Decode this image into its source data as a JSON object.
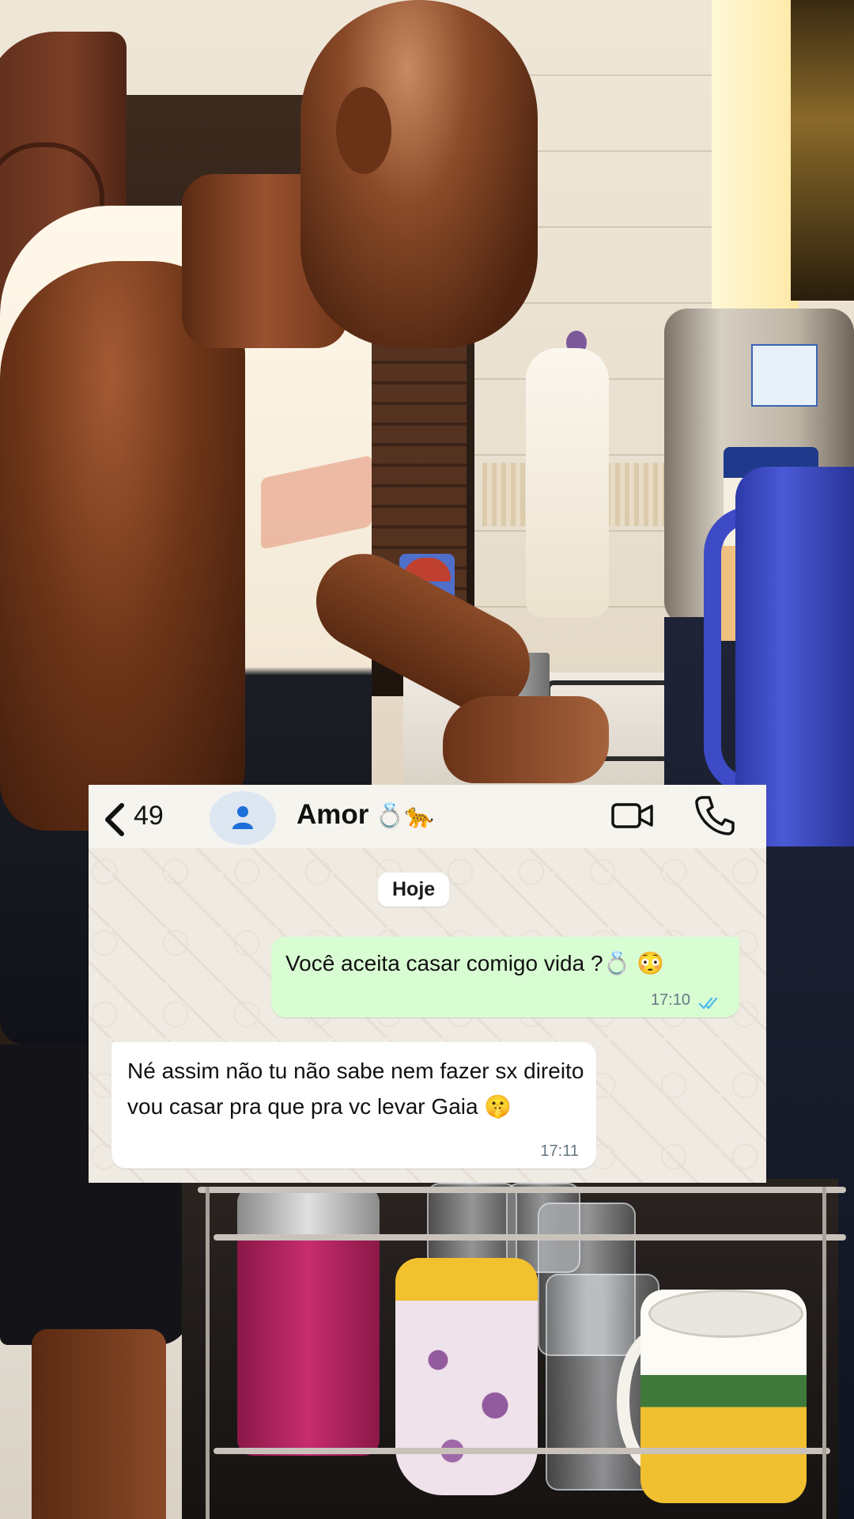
{
  "chat": {
    "unread_count": "49",
    "contact_name": "Amor",
    "contact_emojis": "💍🐆",
    "date_chip": "Hoje",
    "messages": [
      {
        "direction": "outgoing",
        "text": "Você aceita casar comigo vida ?💍 😳",
        "time": "17:10",
        "status": "read"
      },
      {
        "direction": "incoming",
        "text": "Né assim não tu não sabe nem fazer sx direito vou casar pra que  pra vc levar Gaia 🤫",
        "time": "17:11"
      }
    ]
  },
  "icons": {
    "back": "chevron-left-icon",
    "avatar": "person-icon",
    "video": "video-call-icon",
    "call": "phone-icon",
    "read_receipt": "double-check-icon"
  },
  "colors": {
    "outgoing_bubble": "#d9fdd3",
    "incoming_bubble": "#ffffff",
    "chat_background": "#efeae2",
    "read_tick": "#53bdeb",
    "avatar_icon": "#1e6fd9"
  }
}
